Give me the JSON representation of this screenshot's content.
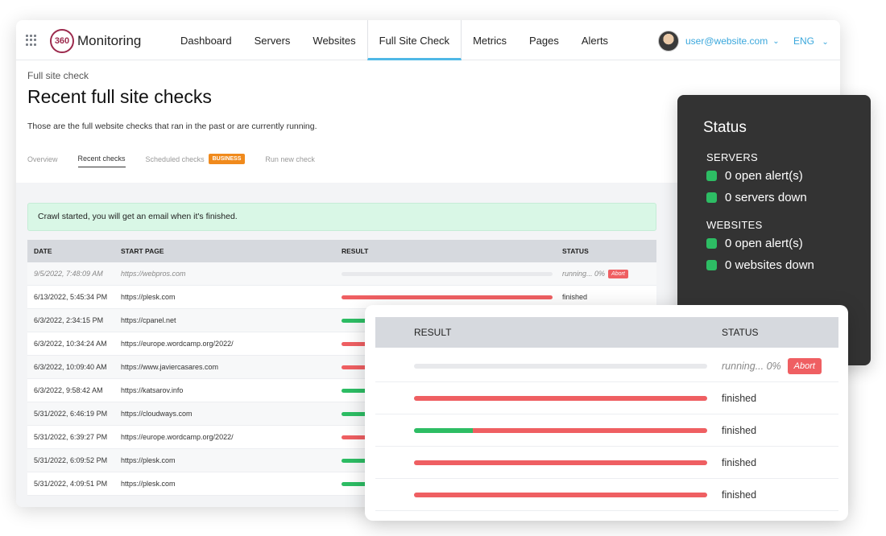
{
  "app": {
    "logo_mark": "360",
    "name": "Monitoring"
  },
  "nav": [
    "Dashboard",
    "Servers",
    "Websites",
    "Full Site Check",
    "Metrics",
    "Pages",
    "Alerts"
  ],
  "nav_active": "Full Site Check",
  "user": {
    "email": "user@website.com",
    "language": "ENG"
  },
  "page": {
    "breadcrumb": "Full site check",
    "title": "Recent full site checks",
    "description": "Those are the full website checks that ran in the past or are currently running.",
    "subtabs": [
      "Overview",
      "Recent checks",
      "Scheduled checks",
      "Run new check"
    ],
    "active_subtab": "Recent checks",
    "business_badge": "BUSINESS"
  },
  "alert": {
    "message": "Crawl started, you will get an email when it's finished."
  },
  "table": {
    "headers": {
      "date": "DATE",
      "start_page": "START PAGE",
      "result": "RESULT",
      "status": "STATUS"
    },
    "rows": [
      {
        "date": "9/5/2022, 7:48:09 AM",
        "start_page": "https://webpros.com",
        "green": 0,
        "red": 0,
        "status": "running... 0%",
        "running": true
      },
      {
        "date": "6/13/2022, 5:45:34 PM",
        "start_page": "https://plesk.com",
        "green": 0,
        "red": 1,
        "status": "finished"
      },
      {
        "date": "6/3/2022, 2:34:15 PM",
        "start_page": "https://cpanel.net",
        "green": 0.2,
        "red": 0.8,
        "status": ""
      },
      {
        "date": "6/3/2022, 10:34:24 AM",
        "start_page": "https://europe.wordcamp.org/2022/",
        "green": 0,
        "red": 1,
        "status": ""
      },
      {
        "date": "6/3/2022, 10:09:40 AM",
        "start_page": "https://www.javiercasares.com",
        "green": 0,
        "red": 1,
        "status": ""
      },
      {
        "date": "6/3/2022, 9:58:42 AM",
        "start_page": "https://katsarov.info",
        "green": 0.2,
        "red": 0.8,
        "status": ""
      },
      {
        "date": "5/31/2022, 6:46:19 PM",
        "start_page": "https://cloudways.com",
        "green": 0.2,
        "red": 0.8,
        "status": ""
      },
      {
        "date": "5/31/2022, 6:39:27 PM",
        "start_page": "https://europe.wordcamp.org/2022/",
        "green": 0,
        "red": 1,
        "status": ""
      },
      {
        "date": "5/31/2022, 6:09:52 PM",
        "start_page": "https://plesk.com",
        "green": 0.2,
        "red": 0.8,
        "status": ""
      },
      {
        "date": "5/31/2022, 4:09:51 PM",
        "start_page": "https://plesk.com",
        "green": 0.2,
        "red": 0.8,
        "status": ""
      }
    ],
    "abort_label": "Abort"
  },
  "status_card": {
    "title": "Status",
    "servers_label": "SERVERS",
    "servers_open_alerts": "0 open alert(s)",
    "servers_down": "0 servers down",
    "websites_label": "WEBSITES",
    "websites_open_alerts": "0 open alert(s)",
    "websites_down": "0 websites down",
    "ok_color": "#2dbd64"
  },
  "zoom": {
    "headers": {
      "result": "RESULT",
      "status": "STATUS"
    },
    "rows": [
      {
        "green": 0,
        "red": 0,
        "status": "running... 0%",
        "running": true
      },
      {
        "green": 0,
        "red": 1,
        "status": "finished"
      },
      {
        "green": 0.2,
        "red": 0.8,
        "status": "finished"
      },
      {
        "green": 0,
        "red": 1,
        "status": "finished"
      },
      {
        "green": 0,
        "red": 1,
        "status": "finished"
      }
    ],
    "abort_label": "Abort"
  },
  "colors": {
    "accent": "#4fb8e6",
    "success": "#2dbd64",
    "danger": "#ef5f62",
    "business": "#f08a1c"
  }
}
